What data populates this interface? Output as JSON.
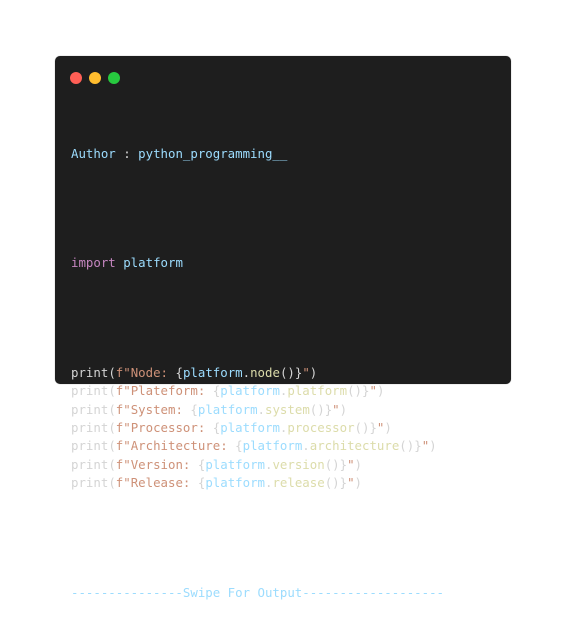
{
  "colors": {
    "window_bg": "#1e1e1e",
    "close_dot": "#ff5f56",
    "minimize_dot": "#ffbd2e",
    "maximize_dot": "#27c93f",
    "identifier": "#9cdcfe",
    "keyword": "#c586c0",
    "function": "#dcdcaa",
    "string": "#ce9178",
    "plain": "#d4d4d4"
  },
  "header": {
    "author_label": "Author",
    "author_sep": " : ",
    "author_value": "python_programming__"
  },
  "import_line": {
    "keyword": "import",
    "module": " platform"
  },
  "print_lines": [
    {
      "fn": "print",
      "open": "(",
      "prefix": "f\"Node: ",
      "lbrace": "{",
      "obj": "platform",
      "dot": ".",
      "method": "node",
      "call": "()",
      "rbrace": "}",
      "suffix": "\"",
      "close": ")"
    },
    {
      "fn": "print",
      "open": "(",
      "prefix": "f\"Plateform: ",
      "lbrace": "{",
      "obj": "platform",
      "dot": ".",
      "method": "platform",
      "call": "()",
      "rbrace": "}",
      "suffix": "\"",
      "close": ")"
    },
    {
      "fn": "print",
      "open": "(",
      "prefix": "f\"System: ",
      "lbrace": "{",
      "obj": "platform",
      "dot": ".",
      "method": "system",
      "call": "()",
      "rbrace": "}",
      "suffix": "\"",
      "close": ")"
    },
    {
      "fn": "print",
      "open": "(",
      "prefix": "f\"Processor: ",
      "lbrace": "{",
      "obj": "platform",
      "dot": ".",
      "method": "processor",
      "call": "()",
      "rbrace": "}",
      "suffix": "\"",
      "close": ")"
    },
    {
      "fn": "print",
      "open": "(",
      "prefix": "f\"Architecture: ",
      "lbrace": "{",
      "obj": "platform",
      "dot": ".",
      "method": "architecture",
      "call": "()",
      "rbrace": "}",
      "suffix": "\"",
      "close": ")"
    },
    {
      "fn": "print",
      "open": "(",
      "prefix": "f\"Version: ",
      "lbrace": "{",
      "obj": "platform",
      "dot": ".",
      "method": "version",
      "call": "()",
      "rbrace": "}",
      "suffix": "\"",
      "close": ")"
    },
    {
      "fn": "print",
      "open": "(",
      "prefix": "f\"Release: ",
      "lbrace": "{",
      "obj": "platform",
      "dot": ".",
      "method": "release",
      "call": "()",
      "rbrace": "}",
      "suffix": "\"",
      "close": ")"
    }
  ],
  "footer": {
    "divider_text": "---------------Swipe For Output-------------------"
  }
}
